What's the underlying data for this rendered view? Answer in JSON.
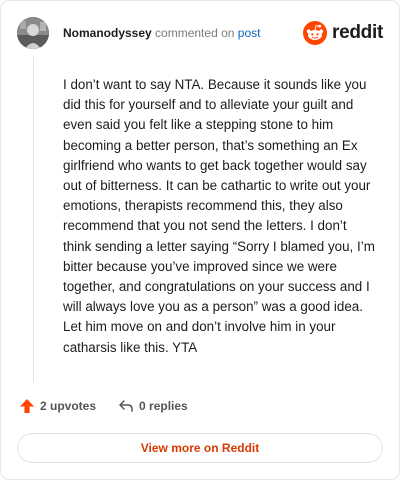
{
  "comment": {
    "author": "Nomanodyssey",
    "action_text": "commented on",
    "target_link": "post",
    "text": "I don’t want to say NTA. Because it sounds like you did this for yourself and to alleviate your guilt and even said you felt like a stepping stone to him becoming a better person, that’s something an Ex girlfriend who wants to get back together would say out of bitterness. It can be cathartic to write out your emotions, therapists recommend this, they also recommend that you not send the letters. I don’t think sending a letter saying “Sorry I blamed you, I’m bitter because you’ve improved since we were together, and congratulations on your success and I will always love you as a person” was a good idea. Let him move on and don’t involve him in your catharsis like this. YTA",
    "upvotes_label": "2 upvotes",
    "replies_label": "0 replies"
  },
  "brand": {
    "name": "reddit",
    "color": "#ff4500"
  },
  "view_more_label": "View more on Reddit",
  "colors": {
    "upvote": "#ff4500",
    "link": "#0a66c2",
    "cta": "#d93a00"
  },
  "icons": {
    "avatar": "avatar-icon",
    "logo": "reddit-logo-icon",
    "upvote": "upvote-arrow-icon",
    "reply": "reply-arrow-icon"
  }
}
